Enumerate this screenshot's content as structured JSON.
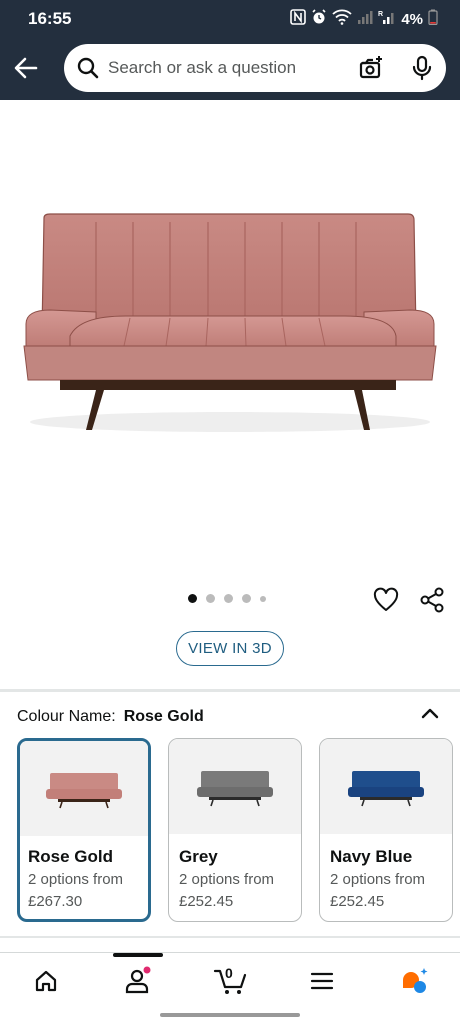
{
  "status_bar": {
    "time": "16:55",
    "battery": "4%",
    "icons": [
      "nfc-icon",
      "alarm-icon",
      "wifi-icon",
      "signal-icon",
      "signal-roaming-icon",
      "battery-icon"
    ]
  },
  "header": {
    "back_icon": "back-arrow-icon",
    "search": {
      "placeholder": "Search or ask a question",
      "value": ""
    },
    "camera_icon": "camera-search-icon",
    "mic_icon": "microphone-icon"
  },
  "product": {
    "image_icon": "sofa-bed-image",
    "carousel_pages": 5,
    "carousel_active": 1,
    "view_3d_label": "VIEW IN 3D"
  },
  "colour": {
    "label": "Colour Name:",
    "selected": "Rose Gold",
    "options": [
      {
        "name": "Rose Gold",
        "options_text": "2 options from",
        "price": "£267.30",
        "color": "#c98a84",
        "leg": "#3a2418"
      },
      {
        "name": "Grey",
        "options_text": "2 options from",
        "price": "£252.45",
        "color": "#7a7a7a",
        "leg": "#2b2b2b"
      },
      {
        "name": "Navy Blue",
        "options_text": "2 options from",
        "price": "£252.45",
        "color": "#1f4e8c",
        "leg": "#2b2b2b"
      }
    ]
  },
  "bottom_nav": {
    "items": [
      "home-icon",
      "account-icon",
      "cart-icon",
      "menu-icon",
      "rufus-ai-icon"
    ],
    "cart_count": "0",
    "active": "account-icon"
  },
  "colors": {
    "header_bg": "#232f3e",
    "accent_blue": "#2a6a8f",
    "notification_dot": "#e02a6f"
  }
}
